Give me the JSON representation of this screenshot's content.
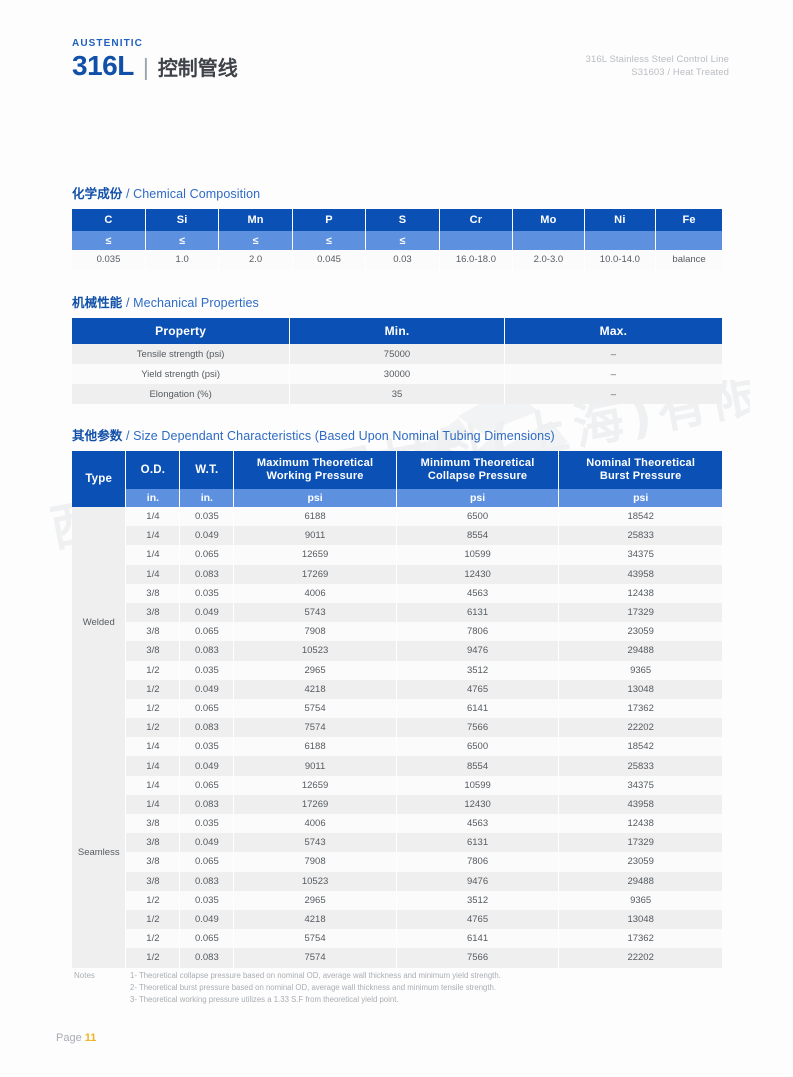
{
  "header": {
    "eyebrow": "AUSTENITIC",
    "grade": "316L",
    "separator": "|",
    "title_cn": "控制管线",
    "meta_line1": "316L Stainless Steel Control Line",
    "meta_line2": "S31603 / Heat Treated"
  },
  "watermark": {
    "text": "西德泰科金属材料(上海)有限公司"
  },
  "sections": {
    "chemical": {
      "title_cn": "化学成份",
      "title_en": "/ Chemical Composition",
      "headers": [
        "C",
        "Si",
        "Mn",
        "P",
        "S",
        "Cr",
        "Mo",
        "Ni",
        "Fe"
      ],
      "subheaders": [
        "≤",
        "≤",
        "≤",
        "≤",
        "≤",
        "",
        "",
        "",
        ""
      ],
      "values": [
        "0.035",
        "1.0",
        "2.0",
        "0.045",
        "0.03",
        "16.0-18.0",
        "2.0-3.0",
        "10.0-14.0",
        "balance"
      ]
    },
    "mechanical": {
      "title_cn": "机械性能",
      "title_en": "/ Mechanical Properties",
      "headers": [
        "Property",
        "Min.",
        "Max."
      ],
      "rows": [
        {
          "property": "Tensile strength (psi)",
          "min": "75000",
          "max": "–"
        },
        {
          "property": "Yield strength (psi)",
          "min": "30000",
          "max": "–"
        },
        {
          "property": "Elongation (%)",
          "min": "35",
          "max": "–"
        }
      ]
    },
    "size": {
      "title_cn": "其他参数",
      "title_en": "/ Size Dependant Characteristics (Based Upon Nominal Tubing Dimensions)",
      "headers": [
        "Type",
        "O.D.",
        "W.T.",
        "Maximum Theoretical Working Pressure",
        "Minimum Theoretical Collapse Pressure",
        "Nominal Theoretical Burst Pressure"
      ],
      "header_lines": [
        [
          "Type"
        ],
        [
          "O.D."
        ],
        [
          "W.T."
        ],
        [
          "Maximum Theoretical",
          "Working Pressure"
        ],
        [
          "Minimum Theoretical",
          "Collapse Pressure"
        ],
        [
          "Nominal Theoretical",
          "Burst Pressure"
        ]
      ],
      "subheaders": [
        "",
        "in.",
        "in.",
        "psi",
        "psi",
        "psi"
      ],
      "groups": [
        {
          "type": "Welded",
          "rows": [
            {
              "od": "1/4",
              "wt": "0.035",
              "working": "6188",
              "collapse": "6500",
              "burst": "18542"
            },
            {
              "od": "1/4",
              "wt": "0.049",
              "working": "9011",
              "collapse": "8554",
              "burst": "25833"
            },
            {
              "od": "1/4",
              "wt": "0.065",
              "working": "12659",
              "collapse": "10599",
              "burst": "34375"
            },
            {
              "od": "1/4",
              "wt": "0.083",
              "working": "17269",
              "collapse": "12430",
              "burst": "43958"
            },
            {
              "od": "3/8",
              "wt": "0.035",
              "working": "4006",
              "collapse": "4563",
              "burst": "12438"
            },
            {
              "od": "3/8",
              "wt": "0.049",
              "working": "5743",
              "collapse": "6131",
              "burst": "17329"
            },
            {
              "od": "3/8",
              "wt": "0.065",
              "working": "7908",
              "collapse": "7806",
              "burst": "23059"
            },
            {
              "od": "3/8",
              "wt": "0.083",
              "working": "10523",
              "collapse": "9476",
              "burst": "29488"
            },
            {
              "od": "1/2",
              "wt": "0.035",
              "working": "2965",
              "collapse": "3512",
              "burst": "9365"
            },
            {
              "od": "1/2",
              "wt": "0.049",
              "working": "4218",
              "collapse": "4765",
              "burst": "13048"
            },
            {
              "od": "1/2",
              "wt": "0.065",
              "working": "5754",
              "collapse": "6141",
              "burst": "17362"
            },
            {
              "od": "1/2",
              "wt": "0.083",
              "working": "7574",
              "collapse": "7566",
              "burst": "22202"
            }
          ]
        },
        {
          "type": "Seamless",
          "rows": [
            {
              "od": "1/4",
              "wt": "0.035",
              "working": "6188",
              "collapse": "6500",
              "burst": "18542"
            },
            {
              "od": "1/4",
              "wt": "0.049",
              "working": "9011",
              "collapse": "8554",
              "burst": "25833"
            },
            {
              "od": "1/4",
              "wt": "0.065",
              "working": "12659",
              "collapse": "10599",
              "burst": "34375"
            },
            {
              "od": "1/4",
              "wt": "0.083",
              "working": "17269",
              "collapse": "12430",
              "burst": "43958"
            },
            {
              "od": "3/8",
              "wt": "0.035",
              "working": "4006",
              "collapse": "4563",
              "burst": "12438"
            },
            {
              "od": "3/8",
              "wt": "0.049",
              "working": "5743",
              "collapse": "6131",
              "burst": "17329"
            },
            {
              "od": "3/8",
              "wt": "0.065",
              "working": "7908",
              "collapse": "7806",
              "burst": "23059"
            },
            {
              "od": "3/8",
              "wt": "0.083",
              "working": "10523",
              "collapse": "9476",
              "burst": "29488"
            },
            {
              "od": "1/2",
              "wt": "0.035",
              "working": "2965",
              "collapse": "3512",
              "burst": "9365"
            },
            {
              "od": "1/2",
              "wt": "0.049",
              "working": "4218",
              "collapse": "4765",
              "burst": "13048"
            },
            {
              "od": "1/2",
              "wt": "0.065",
              "working": "5754",
              "collapse": "6141",
              "burst": "17362"
            },
            {
              "od": "1/2",
              "wt": "0.083",
              "working": "7574",
              "collapse": "7566",
              "burst": "22202"
            }
          ]
        }
      ]
    }
  },
  "notes": {
    "label": "Notes",
    "items": [
      "1- Theoretical collapse pressure based on nominal OD, average wall thickness and minimum yield strength.",
      "2- Theoretical burst pressure based on nominal OD, average wall thickness and minimum tensile strength.",
      "3- Theoretical working pressure utilizes a 1.33 S.F from theoretical yield point."
    ]
  },
  "footer": {
    "page_label": "Page",
    "page_number": "11"
  },
  "colors": {
    "header_blue": "#0b51b5",
    "subheader_blue": "#5d91e0",
    "brand_blue": "#1150a8",
    "accent_yellow": "#f0b323",
    "row_alt": "#efefef"
  }
}
